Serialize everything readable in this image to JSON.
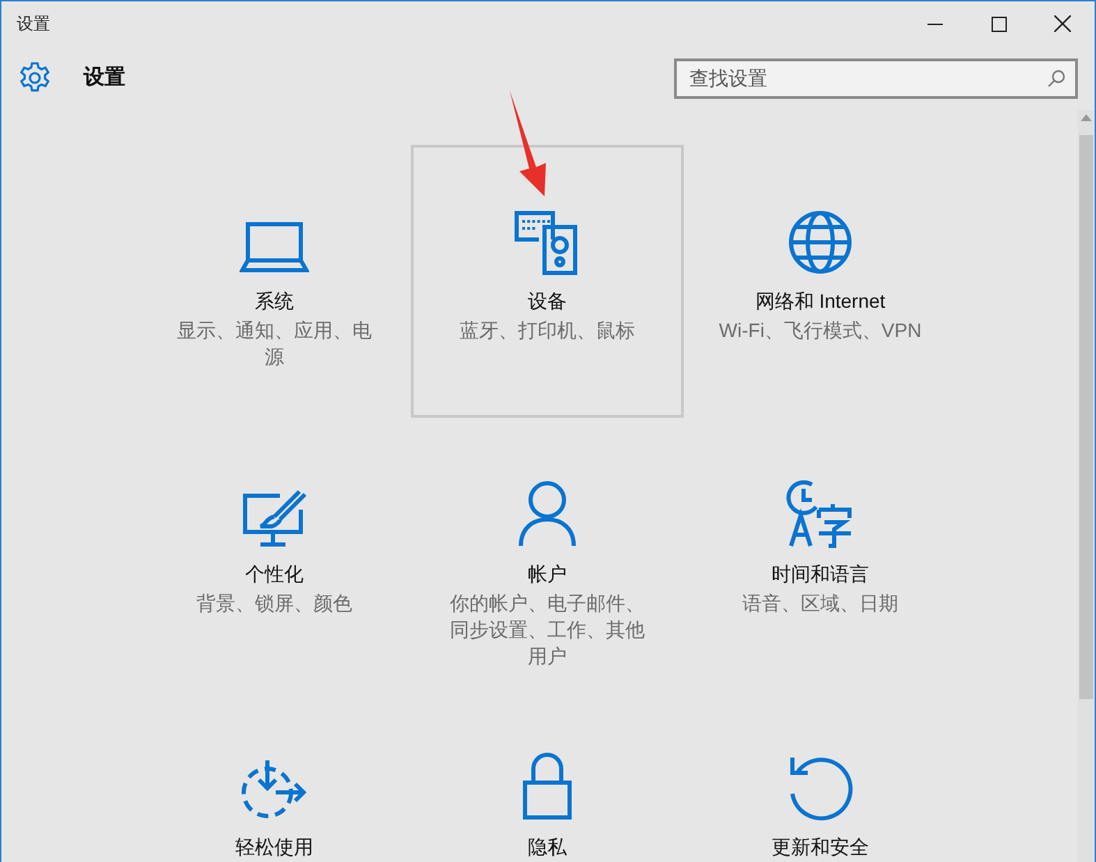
{
  "window": {
    "title": "设置"
  },
  "header": {
    "title": "设置"
  },
  "search": {
    "placeholder": "查找设置"
  },
  "tiles": [
    {
      "kind": "system",
      "title": "系统",
      "subtitle": "显示、通知、应用、电源",
      "selected": false
    },
    {
      "kind": "devices",
      "title": "设备",
      "subtitle": "蓝牙、打印机、鼠标",
      "selected": true
    },
    {
      "kind": "network",
      "title": "网络和 Internet",
      "subtitle": "Wi-Fi、飞行模式、VPN",
      "selected": false
    },
    {
      "kind": "personalization",
      "title": "个性化",
      "subtitle": "背景、锁屏、颜色",
      "selected": false
    },
    {
      "kind": "accounts",
      "title": "帐户",
      "subtitle": "你的帐户、电子邮件、同步设置、工作、其他用户",
      "selected": false
    },
    {
      "kind": "time",
      "title": "时间和语言",
      "subtitle": "语音、区域、日期",
      "selected": false
    },
    {
      "kind": "ease",
      "title": "轻松使用",
      "selected": false
    },
    {
      "kind": "privacy",
      "title": "隐私",
      "selected": false
    },
    {
      "kind": "update",
      "title": "更新和安全",
      "selected": false
    }
  ]
}
